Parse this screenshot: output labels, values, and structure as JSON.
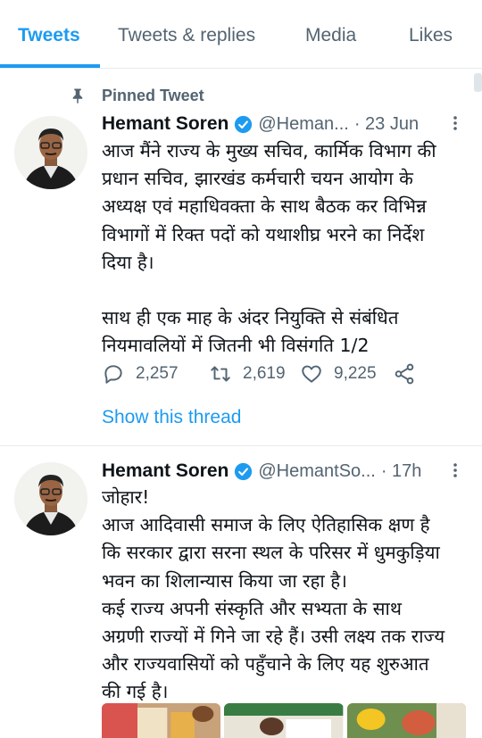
{
  "tabs": [
    {
      "label": "Tweets",
      "active": true
    },
    {
      "label": "Tweets & replies",
      "active": false
    },
    {
      "label": "Media",
      "active": false
    },
    {
      "label": "Likes",
      "active": false
    }
  ],
  "accent_color": "#1d9bf0",
  "tweets": [
    {
      "pinned_label": "Pinned Tweet",
      "name": "Hemant Soren",
      "handle": "@Heman...",
      "time": "· 23 Jun",
      "body": "आज मैंने राज्य के मुख्य सचिव, कार्मिक विभाग की\nप्रधान सचिव, झारखंड कर्मचारी चयन आयोग के\nअध्यक्ष एवं महाधिवक्ता के साथ बैठक कर विभिन्न\nविभागों में रिक्त पदों को यथाशीघ्र भरने का निर्देश\nदिया है।\n\nसाथ ही एक माह के अंदर नियुक्ति से संबंधित\nनियमावलियों में जितनी भी विसंगति 1/2",
      "replies": "2,257",
      "retweets": "2,619",
      "likes": "9,225",
      "show_thread": "Show this thread"
    },
    {
      "name": "Hemant Soren",
      "handle": "@HemantSo...",
      "time": "· 17h",
      "body": "जोहार!\nआज आदिवासी समाज के लिए ऐतिहासिक क्षण है\nकि सरकार द्वारा सरना स्थल के परिसर में धुमकुड़िया\nभवन का शिलान्यास किया जा रहा है।\nकई राज्य अपनी संस्कृति और सभ्यता के साथ\nअग्रणी राज्यों में गिने जा रहे हैं। उसी लक्ष्य तक राज्य\nऔर राज्यवासियों को पहुँचाने के लिए यह शुरुआत\nकी गई है।"
    }
  ],
  "icons": {
    "pin": "pin-icon",
    "verified": "verified-badge-icon",
    "more": "more-icon",
    "reply": "reply-icon",
    "retweet": "retweet-icon",
    "like": "heart-icon",
    "share": "share-icon"
  }
}
